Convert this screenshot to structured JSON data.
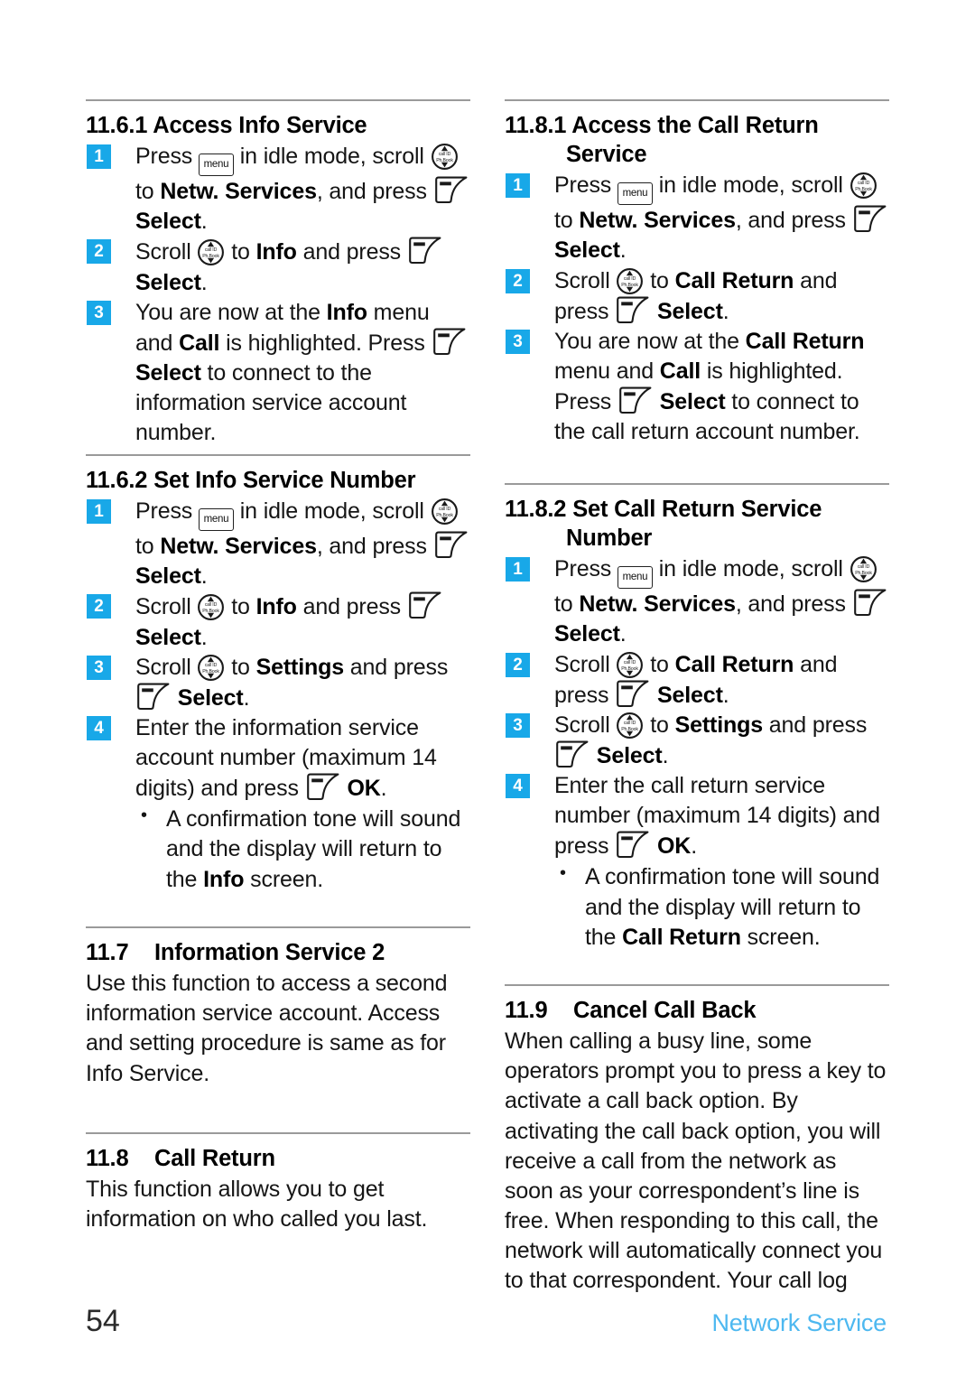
{
  "page": {
    "number": "54",
    "chapter_label": "Network Service",
    "accent_color": "#18a8e8",
    "footer_color": "#4db8f0",
    "rule_color": "#9a9a9a"
  },
  "icons": {
    "menu_key": {
      "name": "menu-key-icon",
      "label": "menu"
    },
    "nav_key": {
      "name": "navigation-key-icon",
      "top_label": "call ID",
      "bottom_label": "Ph.Book"
    },
    "soft_key": {
      "name": "soft-key-icon"
    }
  },
  "left_column": {
    "sections": [
      {
        "id": "11.6.1",
        "heading_number": "11.6.1",
        "heading_title": "Access Info Service",
        "heading_style": "numbered-inline",
        "steps": [
          {
            "badge": "1",
            "parts": [
              {
                "t": "text",
                "v": "Press "
              },
              {
                "t": "icon",
                "v": "menu_key"
              },
              {
                "t": "text",
                "v": " in idle mode, scroll "
              },
              {
                "t": "icon",
                "v": "nav_key"
              },
              {
                "t": "text",
                "v": " to "
              },
              {
                "t": "bold",
                "v": "Netw. Services"
              },
              {
                "t": "text",
                "v": ", and press "
              },
              {
                "t": "icon",
                "v": "soft_key"
              },
              {
                "t": "bold",
                "v": " Select"
              },
              {
                "t": "text",
                "v": "."
              }
            ]
          },
          {
            "badge": "2",
            "parts": [
              {
                "t": "text",
                "v": "Scroll "
              },
              {
                "t": "icon",
                "v": "nav_key"
              },
              {
                "t": "text",
                "v": " to "
              },
              {
                "t": "bold",
                "v": "Info"
              },
              {
                "t": "text",
                "v": " and press "
              },
              {
                "t": "icon",
                "v": "soft_key"
              },
              {
                "t": "bold",
                "v": " Select"
              },
              {
                "t": "text",
                "v": "."
              }
            ]
          },
          {
            "badge": "3",
            "parts": [
              {
                "t": "text",
                "v": "You are now at the "
              },
              {
                "t": "bold",
                "v": "Info"
              },
              {
                "t": "text",
                "v": " menu and "
              },
              {
                "t": "bold",
                "v": "Call"
              },
              {
                "t": "text",
                "v": " is highlighted. Press "
              },
              {
                "t": "icon",
                "v": "soft_key"
              },
              {
                "t": "bold",
                "v": " Select"
              },
              {
                "t": "text",
                "v": " to connect to the information service account number."
              }
            ]
          }
        ]
      },
      {
        "id": "11.6.2",
        "heading_number": "11.6.2",
        "heading_title": "Set Info Service Number",
        "heading_style": "numbered-inline",
        "steps": [
          {
            "badge": "1",
            "parts": [
              {
                "t": "text",
                "v": "Press "
              },
              {
                "t": "icon",
                "v": "menu_key"
              },
              {
                "t": "text",
                "v": " in idle mode, scroll "
              },
              {
                "t": "icon",
                "v": "nav_key"
              },
              {
                "t": "text",
                "v": " to "
              },
              {
                "t": "bold",
                "v": "Netw. Services"
              },
              {
                "t": "text",
                "v": ", and press "
              },
              {
                "t": "icon",
                "v": "soft_key"
              },
              {
                "t": "bold",
                "v": " Select"
              },
              {
                "t": "text",
                "v": "."
              }
            ]
          },
          {
            "badge": "2",
            "parts": [
              {
                "t": "text",
                "v": "Scroll "
              },
              {
                "t": "icon",
                "v": "nav_key"
              },
              {
                "t": "text",
                "v": " to "
              },
              {
                "t": "bold",
                "v": "Info"
              },
              {
                "t": "text",
                "v": " and press "
              },
              {
                "t": "icon",
                "v": "soft_key"
              },
              {
                "t": "bold",
                "v": " Select"
              },
              {
                "t": "text",
                "v": "."
              }
            ]
          },
          {
            "badge": "3",
            "parts": [
              {
                "t": "text",
                "v": "Scroll "
              },
              {
                "t": "icon",
                "v": "nav_key"
              },
              {
                "t": "text",
                "v": " to "
              },
              {
                "t": "bold",
                "v": "Settings"
              },
              {
                "t": "text",
                "v": " and press "
              },
              {
                "t": "icon",
                "v": "soft_key"
              },
              {
                "t": "bold",
                "v": " Select"
              },
              {
                "t": "text",
                "v": "."
              }
            ]
          },
          {
            "badge": "4",
            "parts": [
              {
                "t": "text",
                "v": "Enter the information service account number (maximum 14 digits) and press "
              },
              {
                "t": "icon",
                "v": "soft_key"
              },
              {
                "t": "bold",
                "v": " OK"
              },
              {
                "t": "text",
                "v": "."
              }
            ],
            "bullets": [
              {
                "parts": [
                  {
                    "t": "text",
                    "v": "A confirmation tone will sound and the display will return to the "
                  },
                  {
                    "t": "bold",
                    "v": "Info"
                  },
                  {
                    "t": "text",
                    "v": " screen."
                  }
                ]
              }
            ]
          }
        ]
      },
      {
        "id": "11.7",
        "heading_number": "11.7",
        "heading_title": "Information Service 2",
        "heading_style": "numbered-tab",
        "paragraph": "Use this function to access a second information service account. Access and setting procedure is same as for Info Service."
      },
      {
        "id": "11.8",
        "heading_number": "11.8",
        "heading_title": "Call Return",
        "heading_style": "numbered-tab",
        "paragraph": "This function allows you to get information on who called you last."
      }
    ]
  },
  "right_column": {
    "sections": [
      {
        "id": "11.8.1",
        "heading_number": "11.8.1",
        "heading_title": "Access the Call Return",
        "heading_title_line2": "Service",
        "heading_style": "numbered-wrapped",
        "steps": [
          {
            "badge": "1",
            "parts": [
              {
                "t": "text",
                "v": "Press "
              },
              {
                "t": "icon",
                "v": "menu_key"
              },
              {
                "t": "text",
                "v": " in idle mode, scroll "
              },
              {
                "t": "icon",
                "v": "nav_key"
              },
              {
                "t": "text",
                "v": " to "
              },
              {
                "t": "bold",
                "v": "Netw. Services"
              },
              {
                "t": "text",
                "v": ", and press "
              },
              {
                "t": "icon",
                "v": "soft_key"
              },
              {
                "t": "bold",
                "v": " Select"
              },
              {
                "t": "text",
                "v": "."
              }
            ]
          },
          {
            "badge": "2",
            "parts": [
              {
                "t": "text",
                "v": "Scroll "
              },
              {
                "t": "icon",
                "v": "nav_key"
              },
              {
                "t": "text",
                "v": " to "
              },
              {
                "t": "bold",
                "v": "Call Return"
              },
              {
                "t": "text",
                "v": " and press "
              },
              {
                "t": "icon",
                "v": "soft_key"
              },
              {
                "t": "bold",
                "v": " Select"
              },
              {
                "t": "text",
                "v": "."
              }
            ]
          },
          {
            "badge": "3",
            "parts": [
              {
                "t": "text",
                "v": "You are now at the "
              },
              {
                "t": "bold",
                "v": "Call Return"
              },
              {
                "t": "text",
                "v": " menu and "
              },
              {
                "t": "bold",
                "v": "Call"
              },
              {
                "t": "text",
                "v": " is highlighted. Press "
              },
              {
                "t": "icon",
                "v": "soft_key"
              },
              {
                "t": "bold",
                "v": " Select"
              },
              {
                "t": "text",
                "v": " to connect to the call return account number."
              }
            ]
          }
        ]
      },
      {
        "id": "11.8.2",
        "heading_number": "11.8.2",
        "heading_title": "Set Call Return Service",
        "heading_title_line2": "Number",
        "heading_style": "numbered-wrapped",
        "steps": [
          {
            "badge": "1",
            "parts": [
              {
                "t": "text",
                "v": "Press "
              },
              {
                "t": "icon",
                "v": "menu_key"
              },
              {
                "t": "text",
                "v": " in idle mode, scroll "
              },
              {
                "t": "icon",
                "v": "nav_key"
              },
              {
                "t": "text",
                "v": " to "
              },
              {
                "t": "bold",
                "v": "Netw. Services"
              },
              {
                "t": "text",
                "v": ", and press "
              },
              {
                "t": "icon",
                "v": "soft_key"
              },
              {
                "t": "bold",
                "v": " Select"
              },
              {
                "t": "text",
                "v": "."
              }
            ]
          },
          {
            "badge": "2",
            "parts": [
              {
                "t": "text",
                "v": "Scroll "
              },
              {
                "t": "icon",
                "v": "nav_key"
              },
              {
                "t": "text",
                "v": " to "
              },
              {
                "t": "bold",
                "v": "Call Return"
              },
              {
                "t": "text",
                "v": " and press "
              },
              {
                "t": "icon",
                "v": "soft_key"
              },
              {
                "t": "bold",
                "v": " Select"
              },
              {
                "t": "text",
                "v": "."
              }
            ]
          },
          {
            "badge": "3",
            "parts": [
              {
                "t": "text",
                "v": "Scroll "
              },
              {
                "t": "icon",
                "v": "nav_key"
              },
              {
                "t": "text",
                "v": " to "
              },
              {
                "t": "bold",
                "v": "Settings"
              },
              {
                "t": "text",
                "v": " and press "
              },
              {
                "t": "icon",
                "v": "soft_key"
              },
              {
                "t": "bold",
                "v": " Select"
              },
              {
                "t": "text",
                "v": "."
              }
            ]
          },
          {
            "badge": "4",
            "parts": [
              {
                "t": "text",
                "v": "Enter the call return service number (maximum 14 digits) and press "
              },
              {
                "t": "icon",
                "v": "soft_key"
              },
              {
                "t": "bold",
                "v": " OK"
              },
              {
                "t": "text",
                "v": "."
              }
            ],
            "bullets": [
              {
                "parts": [
                  {
                    "t": "text",
                    "v": "A confirmation tone will sound and the display will return to the "
                  },
                  {
                    "t": "bold",
                    "v": "Call Return"
                  },
                  {
                    "t": "text",
                    "v": " screen."
                  }
                ]
              }
            ]
          }
        ]
      },
      {
        "id": "11.9",
        "heading_number": "11.9",
        "heading_title": "Cancel Call Back",
        "heading_style": "numbered-tab",
        "paragraph": "When calling a busy line, some operators prompt you to press a key to activate a call back option. By activating the call back option, you will receive a call from the network as soon as your correspondent’s line is free. When responding to this call, the network will automatically connect you to that correspondent. Your call log"
      }
    ]
  }
}
